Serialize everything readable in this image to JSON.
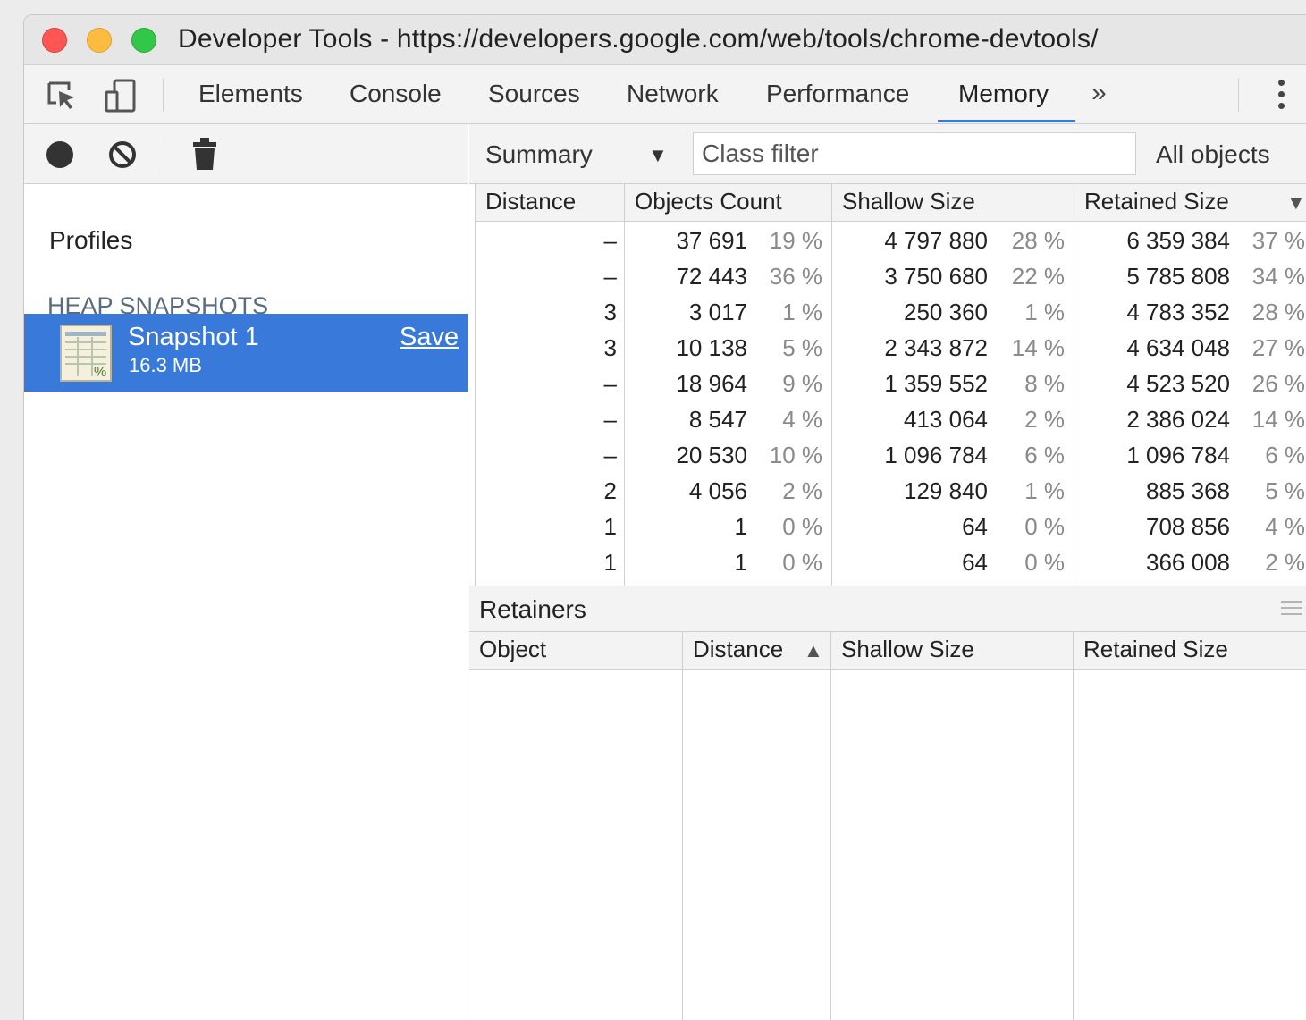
{
  "window": {
    "title": "Developer Tools - https://developers.google.com/web/tools/chrome-devtools/"
  },
  "tabs": {
    "items": [
      {
        "label": "Elements"
      },
      {
        "label": "Console"
      },
      {
        "label": "Sources"
      },
      {
        "label": "Network"
      },
      {
        "label": "Performance"
      },
      {
        "label": "Memory",
        "active": true
      }
    ],
    "overflow_label": "»"
  },
  "left_panel": {
    "profiles_label": "Profiles",
    "section_label": "HEAP SNAPSHOTS",
    "snapshot": {
      "name": "Snapshot 1",
      "size": "16.3 MB",
      "save_label": "Save"
    }
  },
  "toolbar": {
    "view": "Summary",
    "filter_placeholder": "Class filter",
    "scope": "All objects"
  },
  "table": {
    "headers": {
      "distance": "Distance",
      "objects_count": "Objects Count",
      "shallow_size": "Shallow Size",
      "retained_size": "Retained Size"
    },
    "rows": [
      {
        "distance": "–",
        "count": "37 691",
        "count_pct": "19 %",
        "shallow": "4 797 880",
        "shallow_pct": "28 %",
        "retained": "6 359 384",
        "retained_pct": "37 %"
      },
      {
        "distance": "–",
        "count": "72 443",
        "count_pct": "36 %",
        "shallow": "3 750 680",
        "shallow_pct": "22 %",
        "retained": "5 785 808",
        "retained_pct": "34 %"
      },
      {
        "distance": "3",
        "count": "3 017",
        "count_pct": "1 %",
        "shallow": "250 360",
        "shallow_pct": "1 %",
        "retained": "4 783 352",
        "retained_pct": "28 %"
      },
      {
        "distance": "3",
        "count": "10 138",
        "count_pct": "5 %",
        "shallow": "2 343 872",
        "shallow_pct": "14 %",
        "retained": "4 634 048",
        "retained_pct": "27 %"
      },
      {
        "distance": "–",
        "count": "18 964",
        "count_pct": "9 %",
        "shallow": "1 359 552",
        "shallow_pct": "8 %",
        "retained": "4 523 520",
        "retained_pct": "26 %"
      },
      {
        "distance": "–",
        "count": "8 547",
        "count_pct": "4 %",
        "shallow": "413 064",
        "shallow_pct": "2 %",
        "retained": "2 386 024",
        "retained_pct": "14 %"
      },
      {
        "distance": "–",
        "count": "20 530",
        "count_pct": "10 %",
        "shallow": "1 096 784",
        "shallow_pct": "6 %",
        "retained": "1 096 784",
        "retained_pct": "6 %"
      },
      {
        "distance": "2",
        "count": "4 056",
        "count_pct": "2 %",
        "shallow": "129 840",
        "shallow_pct": "1 %",
        "retained": "885 368",
        "retained_pct": "5 %"
      },
      {
        "distance": "1",
        "count": "1",
        "count_pct": "0 %",
        "shallow": "64",
        "shallow_pct": "0 %",
        "retained": "708 856",
        "retained_pct": "4 %"
      },
      {
        "distance": "1",
        "count": "1",
        "count_pct": "0 %",
        "shallow": "64",
        "shallow_pct": "0 %",
        "retained": "366 008",
        "retained_pct": "2 %"
      }
    ]
  },
  "retainers": {
    "title": "Retainers",
    "headers": {
      "object": "Object",
      "distance": "Distance",
      "shallow_size": "Shallow Size",
      "retained_size": "Retained Size"
    }
  },
  "icons": {
    "inspect": "inspect-element-icon",
    "device": "device-toolbar-icon",
    "record": "record-icon",
    "clear": "clear-icon",
    "trash": "trash-icon",
    "snapshot": "heap-snapshot-icon",
    "more": "more-vertical-icon",
    "sort_desc": "sort-descending-icon",
    "sort_asc": "sort-ascending-icon"
  },
  "colors": {
    "accent": "#3879d9",
    "close": "#fc5753",
    "minimize": "#fdbc40",
    "maximize": "#33c748"
  }
}
